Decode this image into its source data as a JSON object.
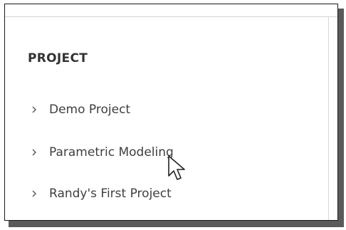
{
  "project_panel": {
    "section_title": "PROJECT",
    "items": [
      {
        "label": "Demo Project",
        "icon": "chevron-right-icon"
      },
      {
        "label": "Parametric Modeling",
        "icon": "chevron-right-icon"
      },
      {
        "label": "Randy's First Project",
        "icon": "chevron-right-icon"
      }
    ]
  },
  "cursor": {
    "icon": "mouse-pointer-icon",
    "hovering": "Parametric Modeling"
  },
  "colors": {
    "text": "#3f3f3f",
    "title": "#333333",
    "border": "#1a1a1a",
    "shadow": "#5a5a5a",
    "divider": "#d4d4d4"
  }
}
